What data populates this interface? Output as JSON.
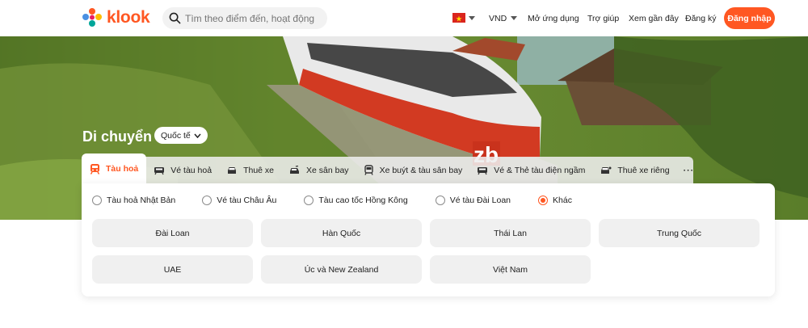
{
  "header": {
    "logo_text": "klook",
    "search_placeholder": "Tìm theo điểm đến, hoạt động",
    "currency": "VND",
    "nav": [
      "Mở ứng dụng",
      "Trợ giúp",
      "Xem gần đây",
      "Đăng ký"
    ],
    "login": "Đăng nhập",
    "flag_icon": "vietnam-flag-icon",
    "brand_color": "#ff5722"
  },
  "hero": {
    "title": "Di chuyển",
    "scope": "Quốc tế"
  },
  "tabs": [
    {
      "label": "Tàu hoả",
      "icon": "train-icon",
      "active": true
    },
    {
      "label": "Vé tàu hoả",
      "icon": "ticket-train-icon"
    },
    {
      "label": "Thuê xe",
      "icon": "car-icon"
    },
    {
      "label": "Xe sân bay",
      "icon": "airport-car-icon"
    },
    {
      "label": "Xe buýt & tàu sân bay",
      "icon": "bus-icon"
    },
    {
      "label": "Vé & Thẻ tàu điện ngầm",
      "icon": "metro-ticket-icon"
    },
    {
      "label": "Thuê xe riêng",
      "icon": "private-car-icon"
    },
    {
      "label": "···",
      "icon": "more-icon"
    }
  ],
  "radios": [
    {
      "label": "Tàu hoả Nhật Bản",
      "checked": false
    },
    {
      "label": "Vé tàu Châu Âu",
      "checked": false
    },
    {
      "label": "Tàu cao tốc Hồng Kông",
      "checked": false
    },
    {
      "label": "Vé tàu Đài Loan",
      "checked": false
    },
    {
      "label": "Khác",
      "checked": true
    }
  ],
  "destinations": [
    "Đài Loan",
    "Hàn Quốc",
    "Thái Lan",
    "Trung Quốc",
    "UAE",
    "Úc và New Zealand",
    "Việt Nam"
  ]
}
